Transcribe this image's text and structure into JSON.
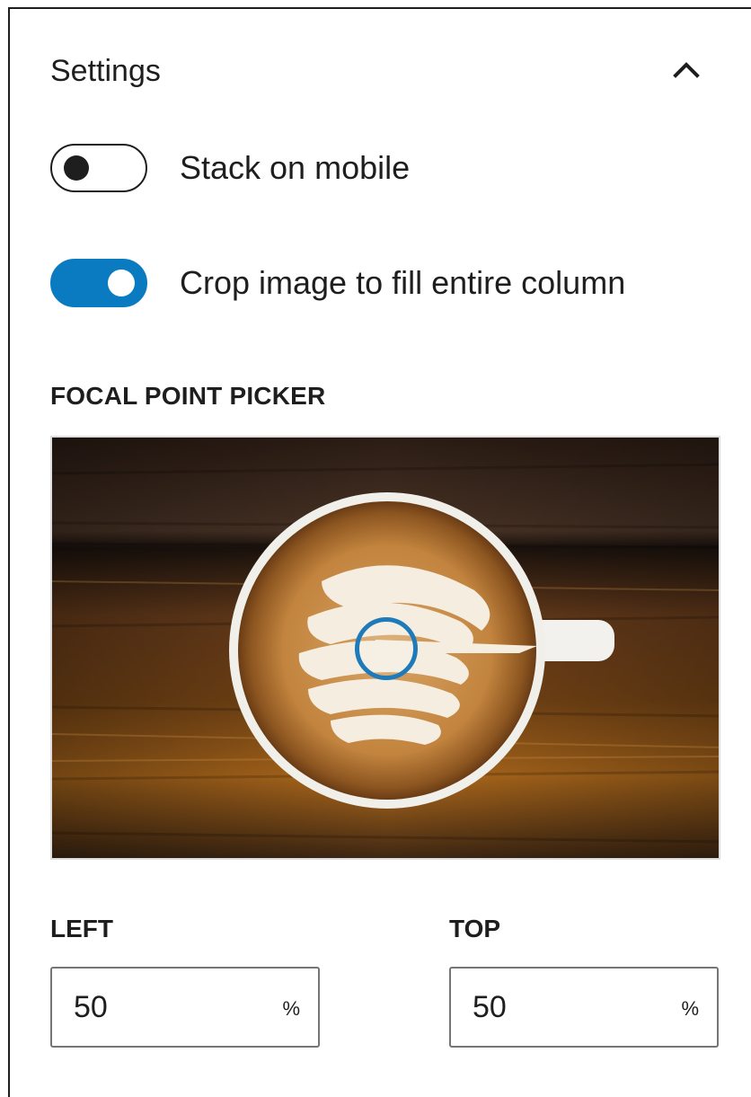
{
  "settings": {
    "title": "Settings",
    "collapse_icon": "chevron-up-icon"
  },
  "toggles": [
    {
      "label": "Stack on mobile",
      "checked": false
    },
    {
      "label": "Crop image to fill entire column",
      "checked": true
    }
  ],
  "focal_picker": {
    "label": "FOCAL POINT PICKER",
    "image_subject": "latte art coffee cup on wooden table",
    "handle_icon": "focal-point-handle-icon",
    "accent_color": "#1f7ab9"
  },
  "coordinates": {
    "left": {
      "label": "LEFT",
      "value": "50",
      "unit": "%"
    },
    "top": {
      "label": "TOP",
      "value": "50",
      "unit": "%"
    }
  },
  "colors": {
    "toggle_on": "#0a7bc0",
    "text": "#1e1e1e"
  }
}
